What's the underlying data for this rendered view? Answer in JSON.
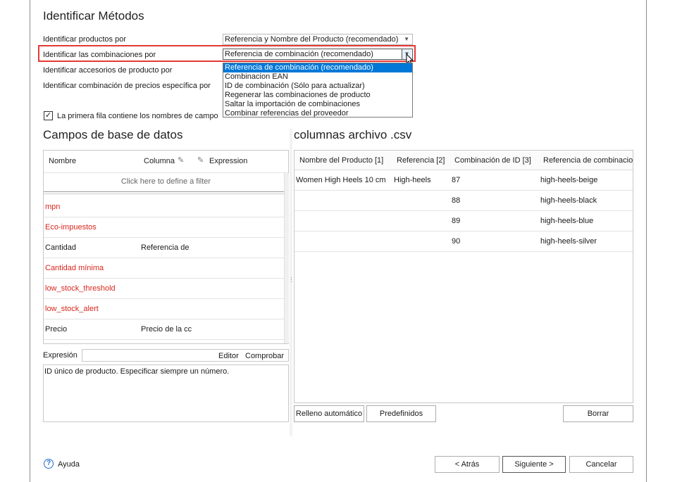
{
  "dialog": {
    "title": "Identificar Métodos"
  },
  "settings": {
    "products_label": "Identificar productos por",
    "products_value": "Referencia y Nombre del Producto (recomendado)",
    "combinations_label": "Identificar las combinaciones por",
    "combinations_value": "Referencia de combinación (recomendado)",
    "accessories_label": "Identificar accesorios de producto por",
    "specific_price_label": "Identificar combinación de precios específica por",
    "dropdown_options": [
      "Referencia de combinación (recomendado)",
      "Combinacion EAN",
      "ID de combinación (Sólo para actualizar)",
      "Regenerar las combinaciones de producto",
      "Saltar la importación de combinaciones",
      "Combinar referencias del proveedor"
    ],
    "first_row_label": "La primera fila contiene los nombres de campo"
  },
  "db_fields": {
    "title": "Campos de base de datos",
    "col_name": "Nombre",
    "col_column": "Columna",
    "col_expression": "Expression",
    "filter_hint": "Click here to define a filter",
    "rows": [
      {
        "name": "mpn",
        "column": ""
      },
      {
        "name": "Eco-impuestos",
        "column": ""
      },
      {
        "name": "Cantidad",
        "column": "Referencia de"
      },
      {
        "name": "Cantidad mínima",
        "column": ""
      },
      {
        "name": "low_stock_threshold",
        "column": ""
      },
      {
        "name": "low_stock_alert",
        "column": ""
      },
      {
        "name": "Precio",
        "column": "Precio de la cc"
      }
    ]
  },
  "expression": {
    "label": "Expresión",
    "editor": "Editor",
    "check": "Comprobar",
    "description": "ID único de producto. Especificar siempre un número."
  },
  "csv": {
    "title": "columnas archivo .csv",
    "headers": [
      "Nombre del Producto [1]",
      "Referencia [2]",
      "Combinación de ID [3]",
      "Referencia de combinacio"
    ],
    "rows": [
      [
        "Women High Heels 10 cm",
        "High-heels",
        "87",
        "high-heels-beige"
      ],
      [
        "",
        "",
        "88",
        "high-heels-black"
      ],
      [
        "",
        "",
        "89",
        "high-heels-blue"
      ],
      [
        "",
        "",
        "90",
        "high-heels-silver"
      ]
    ]
  },
  "buttons": {
    "autofill": "Relleno automático",
    "predefined": "Predefinidos",
    "clear": "Borrar",
    "help": "Ayuda",
    "back": "< Atrás",
    "next": "Siguiente >",
    "cancel": "Cancelar"
  },
  "colors": {
    "accent": "#0078d7",
    "highlight": "#e53935",
    "required_field": "#d9261c"
  }
}
